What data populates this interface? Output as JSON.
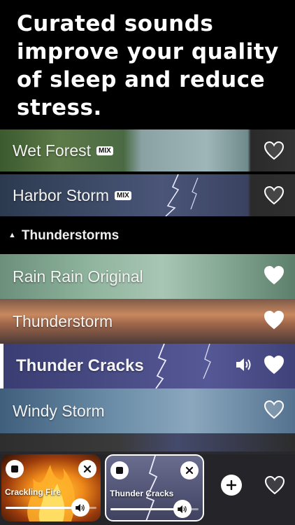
{
  "headline": "Curated sounds improve your quality of sleep and reduce stress.",
  "mix_badge": "MIX",
  "rows_top": [
    {
      "title": "Wet Forest",
      "mix": true,
      "favorited": false
    },
    {
      "title": "Harbor Storm",
      "mix": true,
      "favorited": false
    }
  ],
  "section": {
    "toggle_icon": "triangle-up-icon",
    "title": "Thunderstorms"
  },
  "rows": [
    {
      "title": "Rain Rain Original",
      "favorited": true,
      "playing": false
    },
    {
      "title": "Thunderstorm",
      "favorited": true,
      "playing": false
    },
    {
      "title": "Thunder Cracks",
      "favorited": true,
      "playing": true
    },
    {
      "title": "Windy Storm",
      "favorited": false,
      "playing": false
    }
  ],
  "player": {
    "cards": [
      {
        "label": "Crackling Fire",
        "volume": 0.82,
        "selected": false
      },
      {
        "label": "Thunder Cracks",
        "volume": 0.82,
        "selected": true
      }
    ],
    "favorited": false
  },
  "colors": {
    "accent": "#ffffff",
    "player_bg": "#28282c",
    "selected_border": "#ffffff"
  }
}
